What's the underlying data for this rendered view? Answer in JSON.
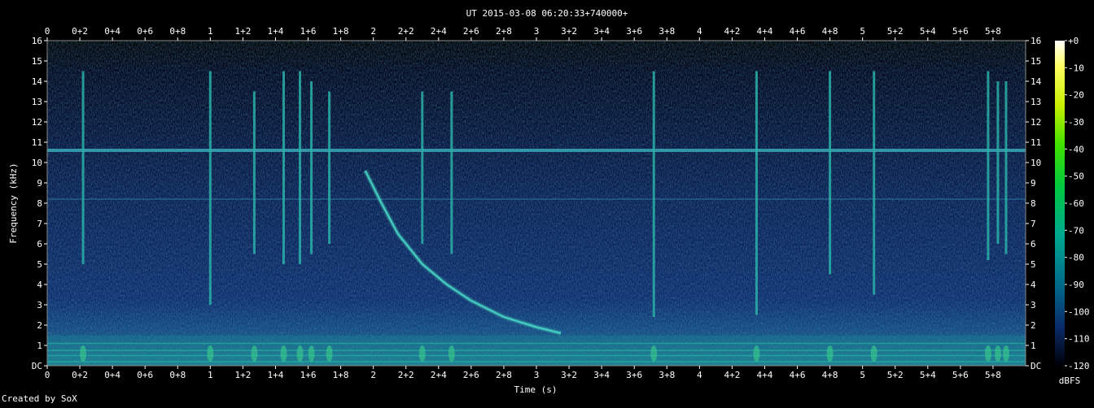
{
  "chart_data": {
    "type": "heatmap",
    "title": "UT 2015-03-08 06:20:33+740000+",
    "xlabel": "Time (s)",
    "ylabel": "Frequency (kHz)",
    "xlim": [
      0,
      6
    ],
    "ylim": [
      0,
      16
    ],
    "x_ticks": [
      "0",
      "0+2",
      "0+4",
      "0+6",
      "0+8",
      "1",
      "1+2",
      "1+4",
      "1+6",
      "1+8",
      "2",
      "2+2",
      "2+4",
      "2+6",
      "2+8",
      "3",
      "3+2",
      "3+4",
      "3+6",
      "3+8",
      "4",
      "4+2",
      "4+4",
      "4+6",
      "4+8",
      "5",
      "5+2",
      "5+4",
      "5+6",
      "5+8"
    ],
    "y_ticks": [
      "DC",
      "1",
      "2",
      "3",
      "4",
      "5",
      "6",
      "7",
      "8",
      "9",
      "10",
      "11",
      "12",
      "13",
      "14",
      "15",
      "16"
    ],
    "colorbar": {
      "label": "dBFS",
      "ticks": [
        "+0",
        "-10",
        "-20",
        "-30",
        "-40",
        "-50",
        "-60",
        "-70",
        "-80",
        "-90",
        "-100",
        "-110",
        "-120"
      ],
      "range": [
        -120,
        0
      ]
    },
    "features": {
      "horizontal_lines_khz": [
        10.6,
        8.2
      ],
      "low_band_khz": [
        0,
        1.5
      ],
      "whistler_curve": [
        [
          1.95,
          9.6
        ],
        [
          2.05,
          8.0
        ],
        [
          2.15,
          6.5
        ],
        [
          2.3,
          5.0
        ],
        [
          2.45,
          4.0
        ],
        [
          2.6,
          3.2
        ],
        [
          2.8,
          2.4
        ],
        [
          3.0,
          1.9
        ],
        [
          3.15,
          1.6
        ]
      ],
      "vertical_spikes": [
        {
          "t": 0.22,
          "f_top": 14.5,
          "f_bot": 5.0
        },
        {
          "t": 1.0,
          "f_top": 14.5,
          "f_bot": 3.0
        },
        {
          "t": 1.27,
          "f_top": 13.5,
          "f_bot": 5.5
        },
        {
          "t": 1.45,
          "f_top": 14.5,
          "f_bot": 5.0
        },
        {
          "t": 1.55,
          "f_top": 14.5,
          "f_bot": 5.0
        },
        {
          "t": 1.62,
          "f_top": 14.0,
          "f_bot": 5.5
        },
        {
          "t": 1.73,
          "f_top": 13.5,
          "f_bot": 6.0
        },
        {
          "t": 2.3,
          "f_top": 13.5,
          "f_bot": 6.0
        },
        {
          "t": 2.48,
          "f_top": 13.5,
          "f_bot": 5.5
        },
        {
          "t": 3.72,
          "f_top": 14.5,
          "f_bot": 2.4
        },
        {
          "t": 4.35,
          "f_top": 14.5,
          "f_bot": 2.5
        },
        {
          "t": 4.8,
          "f_top": 14.5,
          "f_bot": 4.5
        },
        {
          "t": 5.07,
          "f_top": 14.5,
          "f_bot": 3.5
        },
        {
          "t": 5.77,
          "f_top": 14.5,
          "f_bot": 5.2
        },
        {
          "t": 5.83,
          "f_top": 14.0,
          "f_bot": 6.0
        },
        {
          "t": 5.88,
          "f_top": 14.0,
          "f_bot": 5.5
        }
      ]
    }
  },
  "footer": {
    "credit": "Created by SoX"
  },
  "colors": {
    "background": "#000000",
    "low": "#0a1450",
    "mid": "#1a8a8a",
    "high": "#ffffff"
  }
}
